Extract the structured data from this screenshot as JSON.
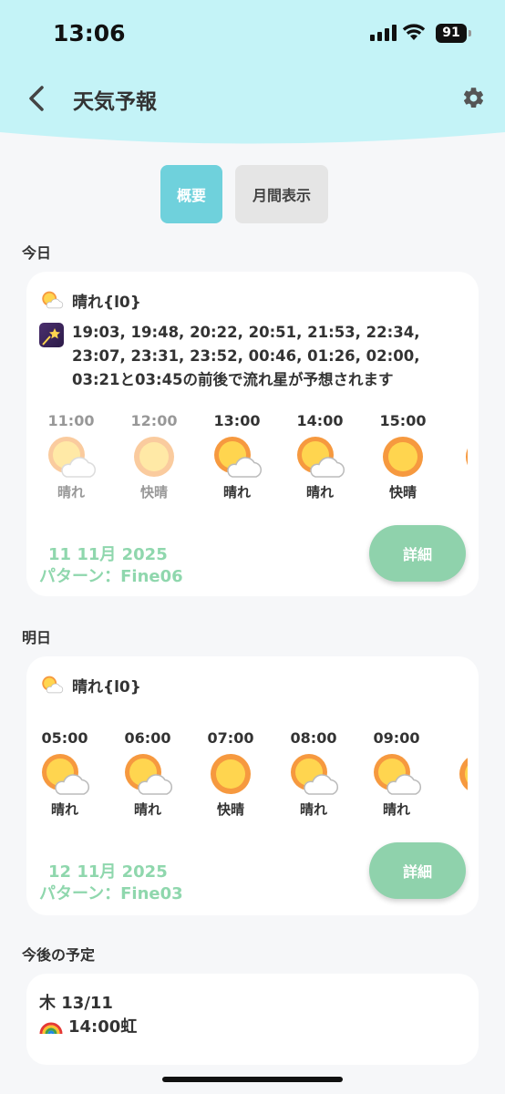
{
  "status": {
    "time": "13:06",
    "battery": "91"
  },
  "nav": {
    "title": "天気予報"
  },
  "tabs": [
    {
      "label": "概要"
    },
    {
      "label": "月間表示"
    }
  ],
  "today": {
    "section_label": "今日",
    "summary": "晴れ{l0}",
    "meteor_text": "19:03, 19:48, 20:22, 20:51, 21:53, 22:34, 23:07, 23:31, 23:52, 00:46, 01:26, 02:00, 03:21と03:45の前後で流れ星が予想されます",
    "hours": [
      {
        "time": "11:00",
        "icon": "sun-cloud-icon",
        "label": "晴れ"
      },
      {
        "time": "12:00",
        "icon": "sun-icon",
        "label": "快晴"
      },
      {
        "time": "13:00",
        "icon": "sun-cloud-icon",
        "label": "晴れ"
      },
      {
        "time": "14:00",
        "icon": "sun-cloud-icon",
        "label": "晴れ"
      },
      {
        "time": "15:00",
        "icon": "sun-icon",
        "label": "快晴"
      }
    ],
    "date": "11 11月 2025",
    "pattern": "パターン：Fine06",
    "detail_label": "詳細"
  },
  "tomorrow": {
    "section_label": "明日",
    "summary": "晴れ{l0}",
    "hours": [
      {
        "time": "05:00",
        "icon": "sun-cloud-icon",
        "label": "晴れ"
      },
      {
        "time": "06:00",
        "icon": "sun-cloud-icon",
        "label": "晴れ"
      },
      {
        "time": "07:00",
        "icon": "sun-icon",
        "label": "快晴"
      },
      {
        "time": "08:00",
        "icon": "sun-cloud-icon",
        "label": "晴れ"
      },
      {
        "time": "09:00",
        "icon": "sun-cloud-icon",
        "label": "晴れ"
      }
    ],
    "date": "12 11月 2025",
    "pattern": "パターン：Fine03",
    "detail_label": "詳細"
  },
  "upcoming": {
    "section_label": "今後の予定",
    "event_date": "木 13/11",
    "event_text": "14:00虹"
  },
  "colors": {
    "accent": "#6fd1dc",
    "green": "#8fd2ac",
    "header": "#c4f3f7"
  }
}
